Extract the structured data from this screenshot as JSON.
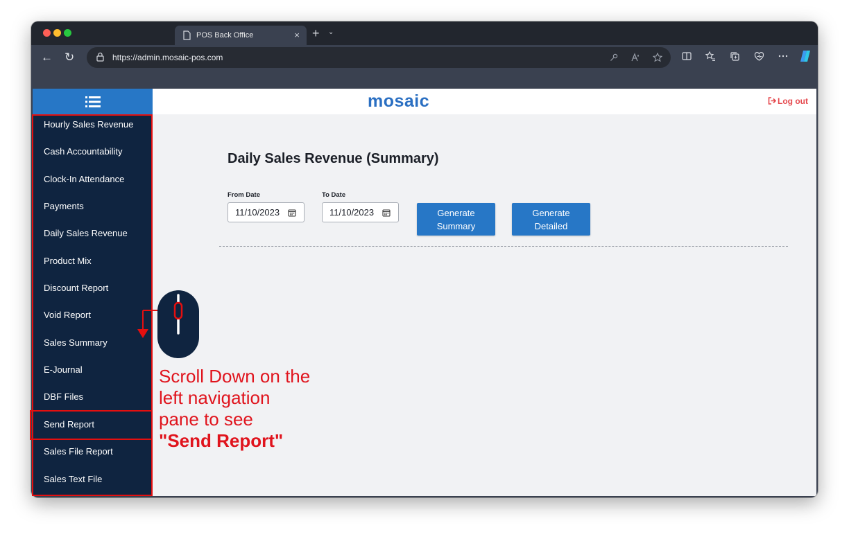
{
  "browser": {
    "tab_title": "POS Back Office",
    "tab_close": "×",
    "new_tab": "+",
    "tab_menu": "⌄",
    "url": "https://admin.mosaic-pos.com",
    "back": "←",
    "reload": "↻"
  },
  "app": {
    "brand": "mosaic",
    "logout_label": "Log out"
  },
  "sidebar": {
    "items": [
      {
        "label": "Hourly Sales Revenue"
      },
      {
        "label": "Cash Accountability"
      },
      {
        "label": "Clock-In Attendance"
      },
      {
        "label": "Payments"
      },
      {
        "label": "Daily Sales Revenue"
      },
      {
        "label": "Product Mix"
      },
      {
        "label": "Discount Report"
      },
      {
        "label": "Void Report"
      },
      {
        "label": "Sales Summary"
      },
      {
        "label": "E-Journal"
      },
      {
        "label": "DBF Files"
      },
      {
        "label": "Send Report"
      },
      {
        "label": "Sales File Report"
      },
      {
        "label": "Sales Text File"
      }
    ]
  },
  "main": {
    "title": "Daily Sales Revenue (Summary)",
    "from_label": "From Date",
    "from_value": "11/10/2023",
    "to_label": "To Date",
    "to_value": "11/10/2023",
    "btn_summary_line1": "Generate",
    "btn_summary_line2": "Summary",
    "btn_detailed_line1": "Generate",
    "btn_detailed_line2": "Detailed"
  },
  "annotation": {
    "line1": "Scroll Down on the",
    "line2": "left navigation",
    "line3": "pane to see",
    "line4": "\"Send Report\"",
    "color": "#e0141d"
  },
  "colors": {
    "sidebar": "#0f2440",
    "accent": "#2777c6",
    "logout": "#e5484d"
  }
}
